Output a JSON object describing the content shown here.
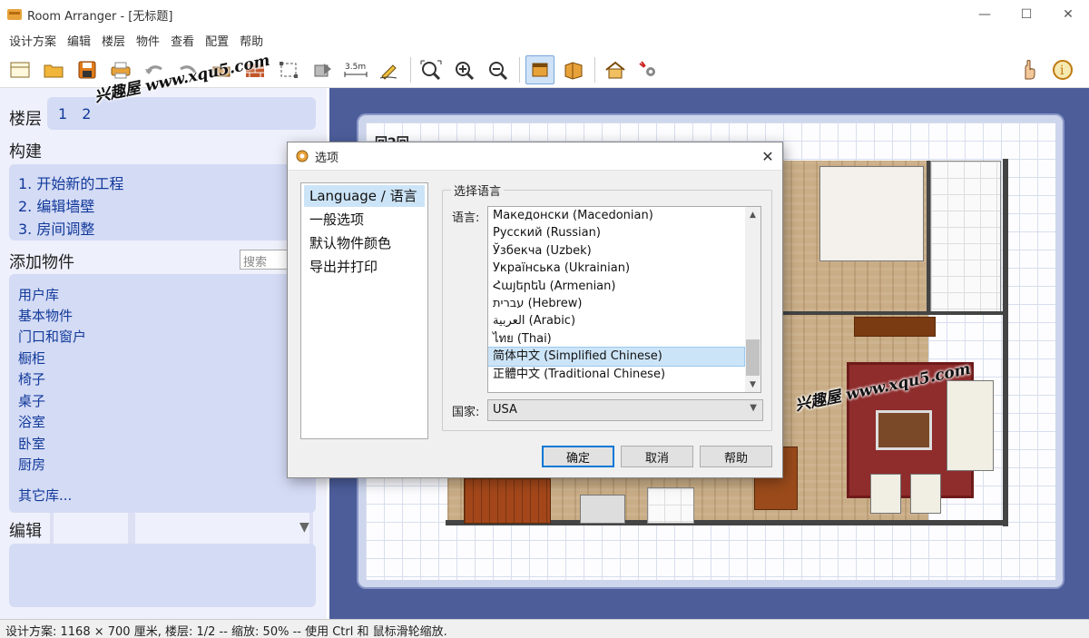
{
  "window": {
    "app_name": "Room Arranger",
    "title": "Room Arranger - [无标题]",
    "controls": {
      "minimize": "—",
      "maximize": "☐",
      "close": "✕"
    }
  },
  "menu": [
    "设计方案",
    "编辑",
    "楼层",
    "物件",
    "查看",
    "配置",
    "帮助"
  ],
  "toolbar": {
    "left_icons": [
      "new-icon",
      "open-icon",
      "save-icon",
      "print-icon",
      "undo-icon",
      "redo-icon",
      "furniture-icon",
      "wall-icon",
      "select-icon",
      "move-icon",
      "measure-icon",
      "draw-icon",
      "zoom-fit-icon",
      "zoom-in-icon",
      "zoom-out-icon",
      "2d-view-icon",
      "3d-view-icon",
      "house-icon",
      "settings-icon"
    ],
    "right_icons": [
      "hand-icon",
      "info-icon"
    ],
    "measure_label": "3.5m",
    "active": "2d-view-icon"
  },
  "left_panel": {
    "floors_heading": "楼层",
    "floors": [
      "1",
      "2"
    ],
    "build_heading": "构建",
    "steps": [
      "1. 开始新的工程",
      "2. 编辑墙壁",
      "3. 房间调整"
    ],
    "add_heading": "添加物件",
    "search_placeholder": "搜索",
    "categories": [
      "用户库",
      "基本物件",
      "门口和窗户",
      "橱柜",
      "椅子",
      "桌子",
      "浴室",
      "卧室",
      "厨房"
    ],
    "arrow": ">",
    "other_library": "其它库...",
    "edit_heading": "编辑",
    "edit_toggle": "▼"
  },
  "canvas": {
    "label": "回2回"
  },
  "watermarks": [
    "兴趣屋 www.xqu5.com",
    "兴趣屋 www.xqu5.com"
  ],
  "dialog": {
    "title": "选项",
    "close": "✕",
    "nav": [
      "Language / 语言",
      "一般选项",
      "默认物件颜色",
      "导出并打印"
    ],
    "nav_selected": 0,
    "group_label": "选择语言",
    "language_label": "语言:",
    "languages": [
      "Македонски (Macedonian)",
      "Русский (Russian)",
      "Ўзбекча (Uzbek)",
      "Українська (Ukrainian)",
      "Հայերեն (Armenian)",
      "עברית  (Hebrew)",
      "العربية (Arabic)",
      "ไทย (Thai)",
      "简体中文 (Simplified Chinese)",
      "正體中文 (Traditional Chinese)"
    ],
    "language_selected": 8,
    "country_label": "国家:",
    "country_value": "USA",
    "buttons": {
      "ok": "确定",
      "cancel": "取消",
      "help": "帮助"
    },
    "scroll_up": "▲",
    "scroll_down": "▼"
  },
  "statusbar": {
    "text": "设计方案: 1168 × 700 厘米, 楼层: 1/2 -- 缩放: 50% -- 使用 Ctrl 和 鼠标滑轮缩放."
  }
}
